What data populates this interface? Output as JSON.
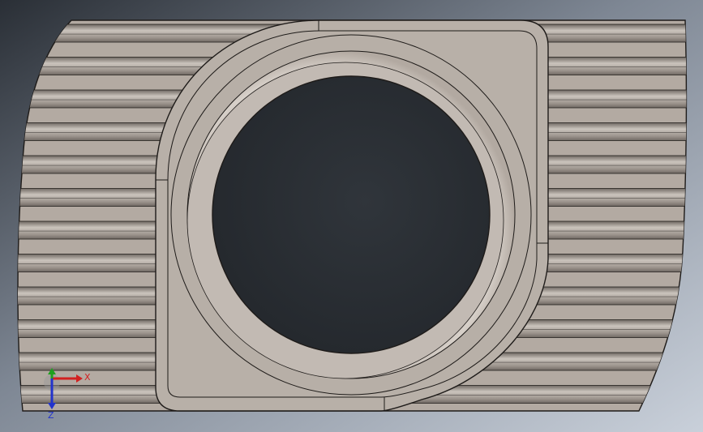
{
  "viewport": {
    "background_top": "#2a2f36",
    "background_mid": "#7e8794",
    "background_bottom": "#c9d0da"
  },
  "model": {
    "part": "t-slot-nut",
    "view": "top",
    "body_color": "#b3aaa2",
    "groove_color": "#9c948d",
    "groove_light": "#cbc4bd",
    "groove_dark": "#6f6862",
    "pad_color": "#b8b0a8",
    "bore_color": "#2a2e33",
    "chamfer_color": "#c6bfb8",
    "edge_color": "#1e1b19"
  },
  "triad": {
    "x_label": "X",
    "y_label": "Y",
    "z_label": "Z",
    "x_color": "#d22020",
    "y_color": "#1ea01e",
    "z_color": "#2233cc"
  }
}
